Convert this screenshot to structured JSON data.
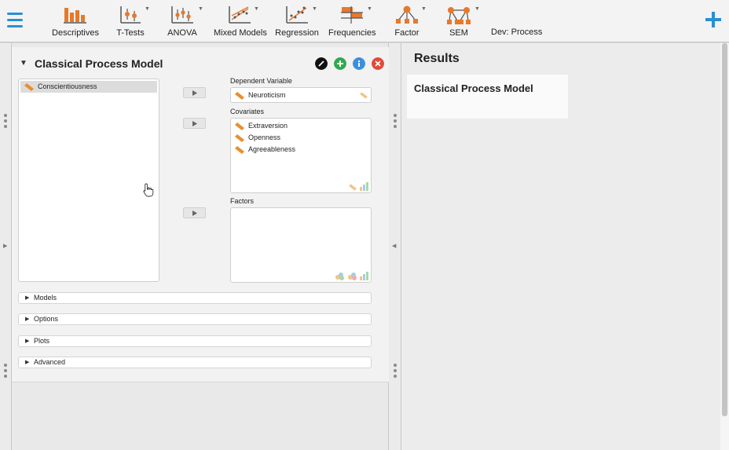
{
  "toolbar": {
    "tools": [
      {
        "label": "Descriptives",
        "icon": "descriptives-icon"
      },
      {
        "label": "T-Tests",
        "icon": "t-tests-icon"
      },
      {
        "label": "ANOVA",
        "icon": "anova-icon"
      },
      {
        "label": "Mixed Models",
        "icon": "mixed-models-icon"
      },
      {
        "label": "Regression",
        "icon": "regression-icon"
      },
      {
        "label": "Frequencies",
        "icon": "frequencies-icon"
      },
      {
        "label": "Factor",
        "icon": "factor-icon"
      },
      {
        "label": "SEM",
        "icon": "sem-icon"
      }
    ],
    "dev_label": "Dev: Process"
  },
  "analysis": {
    "title": "Classical Process Model",
    "available_variables": [
      "Conscientiousness"
    ],
    "dependent_label": "Dependent Variable",
    "dependent_value": "Neuroticism",
    "covariates_label": "Covariates",
    "covariates": [
      "Extraversion",
      "Openness",
      "Agreeableness"
    ],
    "factors_label": "Factors",
    "sections": [
      "Models",
      "Options",
      "Plots",
      "Advanced"
    ]
  },
  "results": {
    "heading": "Results",
    "card_title": "Classical Process Model"
  },
  "colors": {
    "accent_blue": "#2a8fd4",
    "tool_orange": "#e8782a",
    "edit_black": "#111111",
    "add_green": "#2fa84f",
    "info_blue": "#3b8fdc",
    "close_red": "#e04a3c"
  }
}
